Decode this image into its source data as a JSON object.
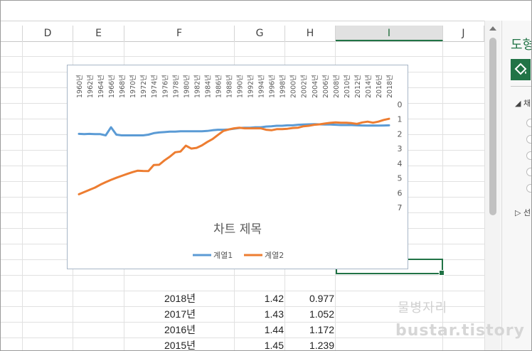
{
  "columns": [
    {
      "label": "D",
      "selected": false
    },
    {
      "label": "E",
      "selected": false
    },
    {
      "label": "F",
      "selected": false
    },
    {
      "label": "G",
      "selected": false
    },
    {
      "label": "H",
      "selected": false
    },
    {
      "label": "I",
      "selected": true
    },
    {
      "label": "J",
      "selected": false
    }
  ],
  "rows": [
    {
      "year": "2018년",
      "g": "1.42",
      "h": "0.977"
    },
    {
      "year": "2017년",
      "g": "1.43",
      "h": "1.052"
    },
    {
      "year": "2016년",
      "g": "1.44",
      "h": "1.172"
    },
    {
      "year": "2015년",
      "g": "1.45",
      "h": "1.239"
    }
  ],
  "side_pane": {
    "title": "도형",
    "section_fill": "채",
    "section_line": "선",
    "fill_icon": "paint-bucket-icon",
    "expand_icon": "triangle-expand-icon",
    "collapse_icon": "triangle-collapse-icon"
  },
  "chart_data": {
    "type": "line",
    "title": "차트 제목",
    "orientation": "x-axis on top, y-axis on right reversed",
    "categories": [
      "1960년",
      "1962년",
      "1964년",
      "1966년",
      "1968년",
      "1970년",
      "1972년",
      "1974년",
      "1976년",
      "1978년",
      "1980년",
      "1982년",
      "1984년",
      "1986년",
      "1988년",
      "1990년",
      "1992년",
      "1994년",
      "1996년",
      "1998년",
      "2000년",
      "2002년",
      "2004년",
      "2006년",
      "2008년",
      "2010년",
      "2012년",
      "2014년",
      "2016년",
      "2018년"
    ],
    "x": [
      1960,
      1961,
      1962,
      1963,
      1964,
      1965,
      1966,
      1967,
      1968,
      1969,
      1970,
      1971,
      1972,
      1973,
      1974,
      1975,
      1976,
      1977,
      1978,
      1979,
      1980,
      1981,
      1982,
      1983,
      1984,
      1985,
      1986,
      1987,
      1988,
      1989,
      1990,
      1991,
      1992,
      1993,
      1994,
      1995,
      1996,
      1997,
      1998,
      1999,
      2000,
      2001,
      2002,
      2003,
      2004,
      2005,
      2006,
      2007,
      2008,
      2009,
      2010,
      2011,
      2012,
      2013,
      2014,
      2015,
      2016,
      2017,
      2018
    ],
    "series": [
      {
        "name": "계열1",
        "color": "#5b9bd5",
        "values": [
          2.0,
          2.02,
          2.0,
          2.02,
          2.02,
          2.1,
          1.55,
          2.05,
          2.1,
          2.1,
          2.1,
          2.1,
          2.1,
          2.05,
          1.95,
          1.9,
          1.88,
          1.85,
          1.85,
          1.82,
          1.82,
          1.82,
          1.82,
          1.82,
          1.8,
          1.75,
          1.72,
          1.72,
          1.7,
          1.65,
          1.6,
          1.58,
          1.58,
          1.55,
          1.55,
          1.5,
          1.48,
          1.45,
          1.45,
          1.42,
          1.42,
          1.38,
          1.36,
          1.35,
          1.34,
          1.35,
          1.36,
          1.36,
          1.38,
          1.4,
          1.4,
          1.4,
          1.42,
          1.43,
          1.44,
          1.43,
          1.44,
          1.43,
          1.42
        ]
      },
      {
        "name": "계열2",
        "color": "#ed7d31",
        "values": [
          6.1,
          5.95,
          5.8,
          5.65,
          5.45,
          5.28,
          5.12,
          4.98,
          4.85,
          4.72,
          4.6,
          4.5,
          4.52,
          4.53,
          4.12,
          4.1,
          3.8,
          3.55,
          3.25,
          3.2,
          2.8,
          3.0,
          2.95,
          2.78,
          2.55,
          2.35,
          2.07,
          1.8,
          1.7,
          1.62,
          1.58,
          1.62,
          1.62,
          1.62,
          1.62,
          1.72,
          1.75,
          1.68,
          1.68,
          1.65,
          1.6,
          1.58,
          1.48,
          1.45,
          1.38,
          1.35,
          1.3,
          1.25,
          1.22,
          1.24,
          1.24,
          1.27,
          1.32,
          1.22,
          1.17,
          1.24,
          1.17,
          1.05,
          0.977
        ]
      }
    ],
    "yaxis": {
      "min": 0,
      "max": 7,
      "reversed": true,
      "ticks": [
        "0",
        "1",
        "2",
        "3",
        "4",
        "5",
        "6",
        "7"
      ],
      "position": "right"
    },
    "grid": false,
    "legend": {
      "position": "bottom",
      "entries": [
        "계열1",
        "계열2"
      ]
    }
  },
  "watermark": {
    "line1": "물병자리",
    "line2": "bustar.tistory"
  }
}
